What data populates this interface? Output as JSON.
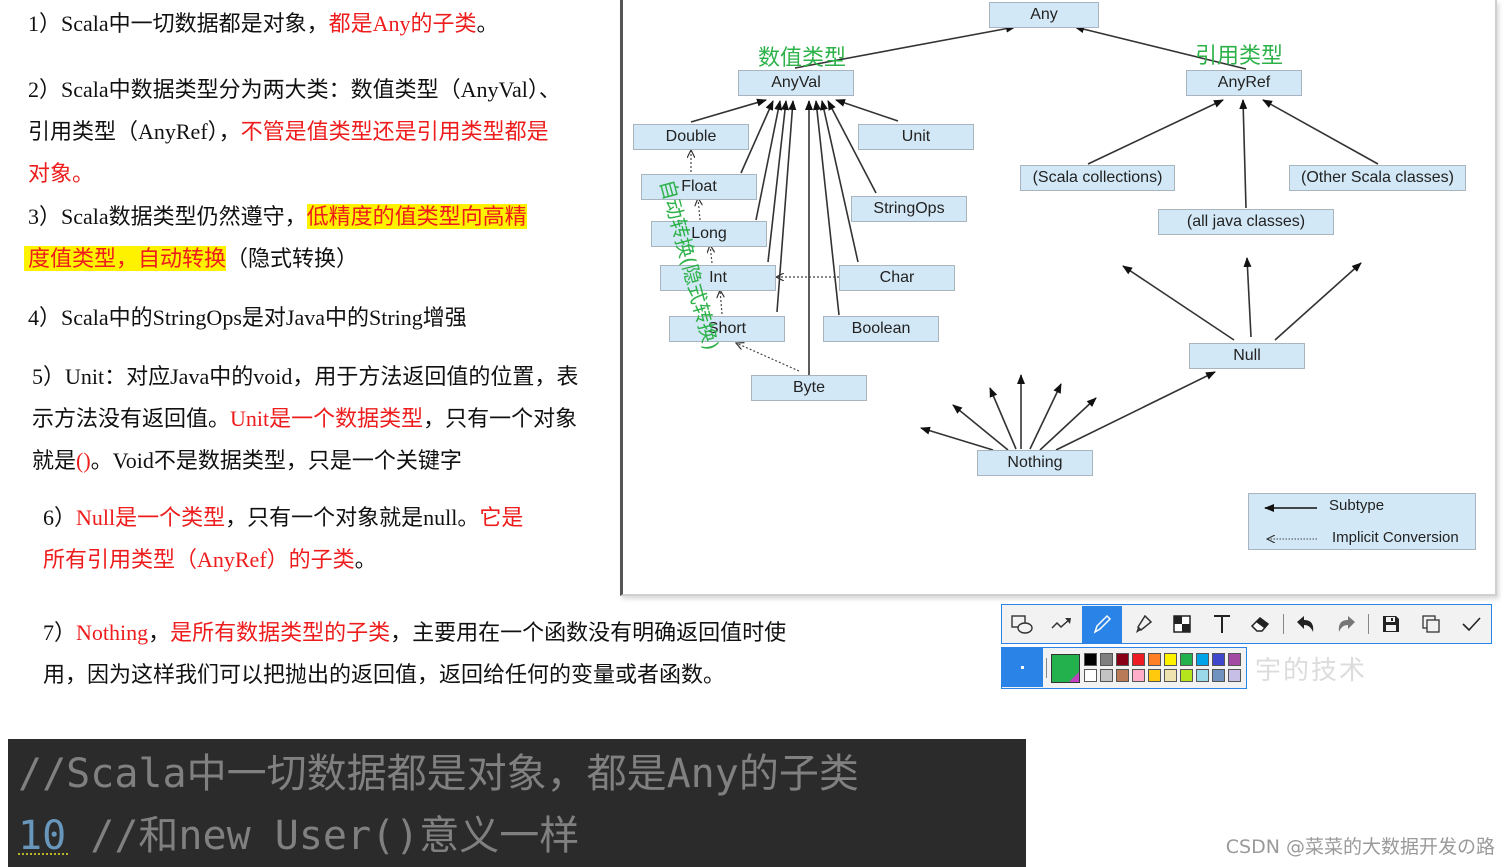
{
  "notes": {
    "n1": {
      "prefix": "1）Scala中一切数据都是对象，",
      "red": "都是Any的子类",
      "suffix": "。"
    },
    "n2": {
      "line1": "2）Scala中数据类型分为两大类：数值类型（AnyVal）、",
      "line2_prefix": "引用类型（AnyRef），",
      "line2_red": "不管是值类型还是引用类型都是",
      "line3_red": "对象。"
    },
    "n3": {
      "line1_prefix": "3）Scala数据类型仍然遵守，",
      "line1_hl": "低精度的值类型向高精",
      "line2_hl": "度值类型，自动转换",
      "line2_suffix": "（隐式转换）"
    },
    "n4": {
      "text": "4）Scala中的StringOps是对Java中的String增强"
    },
    "n5": {
      "line1": "5）Unit：对应Java中的void，用于方法返回值的位置，表",
      "line2_prefix": "示方法没有返回值。",
      "line2_red": "Unit是一个数据类型",
      "line2_suffix": "，只有一个对象",
      "line3_prefix": "就是",
      "line3_red": "()",
      "line3_suffix": "。Void不是数据类型，只是一个关键字"
    },
    "n6": {
      "line1_prefix": "6）",
      "line1_red": "Null是一个类型",
      "line1_mid": "，只有一个对象就是null。",
      "line1_red2": "它是",
      "line2_red": "所有引用类型（AnyRef）的子类",
      "line2_suffix": "。"
    },
    "n7": {
      "line1_prefix": "7）",
      "line1_red": "Nothing",
      "line1_mid": "，",
      "line1_red2": "是所有数据类型的子类",
      "line1_suffix": "，主要用在一个函数没有明确返回值时使",
      "line2": "用，因为这样我们可以把抛出的返回值，返回给任何的变量或者函数。"
    }
  },
  "diagram": {
    "nodes": {
      "any": "Any",
      "anyval": "AnyVal",
      "anyref": "AnyRef",
      "double": "Double",
      "float": "Float",
      "long": "Long",
      "int": "Int",
      "short": "Short",
      "byte": "Byte",
      "unit": "Unit",
      "stringops": "StringOps",
      "char": "Char",
      "boolean": "Boolean",
      "scala_collections": "(Scala collections)",
      "other_scala": "(Other Scala classes)",
      "java_classes": "(all java classes)",
      "null": "Null",
      "nothing": "Nothing"
    },
    "annotations": {
      "value_types": "数值类型",
      "ref_types": "引用类型",
      "auto_conversion": "自动转换(隐式转换)"
    },
    "legend": {
      "subtype": "Subtype",
      "implicit": "Implicit Conversion"
    },
    "colors": {
      "node_fill": "#d3e8f6",
      "annotation": "#2db24a"
    }
  },
  "toolbar": {
    "tools": [
      {
        "name": "shape-tool",
        "icon": "rect-ellipse-icon"
      },
      {
        "name": "arrow-tool",
        "icon": "arrow-line-icon"
      },
      {
        "name": "pen-tool",
        "icon": "pencil-icon",
        "active": true
      },
      {
        "name": "marker-tool",
        "icon": "highlighter-icon"
      },
      {
        "name": "mosaic-tool",
        "icon": "mosaic-icon"
      },
      {
        "name": "text-tool",
        "icon": "text-icon"
      },
      {
        "name": "eraser-tool",
        "icon": "eraser-icon"
      },
      {
        "name": "undo",
        "icon": "undo-icon"
      },
      {
        "name": "redo",
        "icon": "redo-icon"
      },
      {
        "name": "save",
        "icon": "save-icon"
      },
      {
        "name": "copy",
        "icon": "copy-icon"
      },
      {
        "name": "done",
        "icon": "check-icon"
      }
    ],
    "accent": "#2a83e6",
    "current_color": "#22b14c",
    "palette_top": [
      "#000000",
      "#7f7f7f",
      "#880015",
      "#ed1c24",
      "#ff7f27",
      "#fff200",
      "#22b14c",
      "#00a2e8",
      "#3f48cc",
      "#a349a4"
    ],
    "palette_bottom": [
      "#ffffff",
      "#c3c3c3",
      "#b97a57",
      "#ffaec9",
      "#ffc90e",
      "#efe4b0",
      "#b5e61d",
      "#99d9ea",
      "#7092be",
      "#c8bfe7"
    ]
  },
  "faint_watermark": "宇的技术",
  "code": {
    "line1": "//Scala中一切数据都是对象，都是Any的子类",
    "line2_num": "10",
    "line2_comment": " //和new User()意义一样"
  },
  "watermark": "CSDN @菜菜的大数据开发の路"
}
